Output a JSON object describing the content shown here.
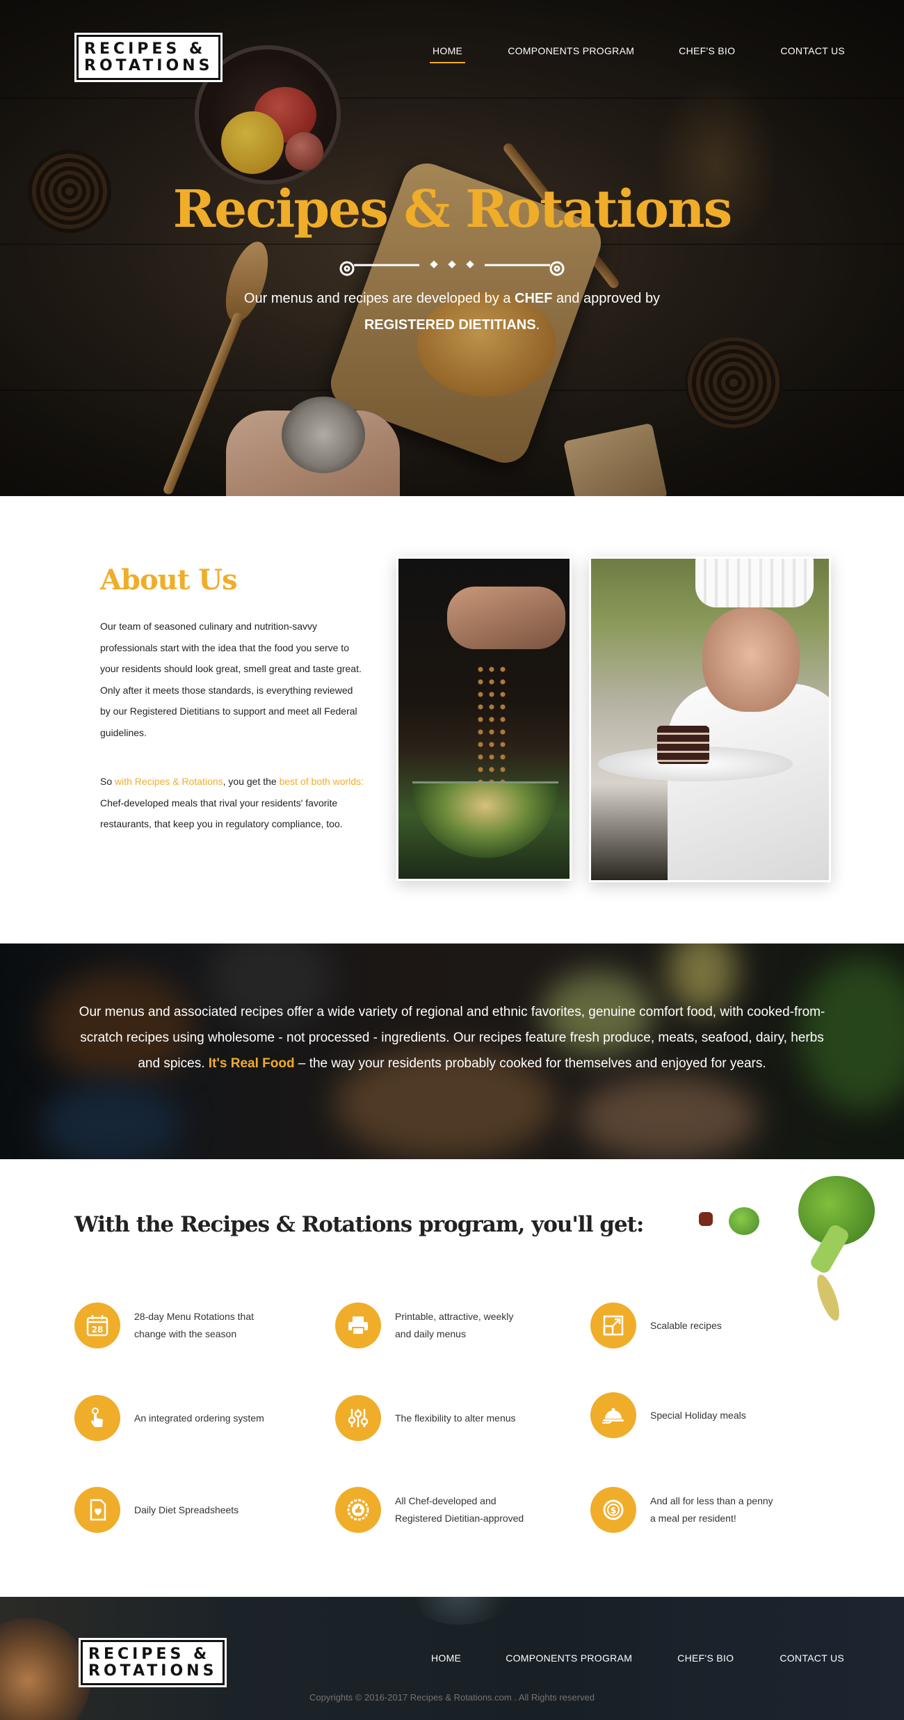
{
  "brand": {
    "line1": "RECIPES &",
    "line2": "ROTATIONS"
  },
  "nav": {
    "items": [
      {
        "label": "HOME",
        "active": true
      },
      {
        "label": "COMPONENTS PROGRAM",
        "active": false
      },
      {
        "label": "CHEF'S BIO",
        "active": false
      },
      {
        "label": "CONTACT US",
        "active": false
      }
    ]
  },
  "hero": {
    "title": "Recipes & Rotations",
    "subtitle_part1": "Our menus and recipes are developed by a ",
    "subtitle_bold1": "CHEF",
    "subtitle_part2": " and approved by",
    "subtitle_bold2": "REGISTERED DIETITIANS",
    "subtitle_end": "."
  },
  "about": {
    "title": "About Us",
    "paragraph1": "Our team of seasoned culinary and nutrition-savvy professionals start with the idea that the food you serve to your residents should look great, smell great and taste great. Only after it meets those standards, is everything reviewed by our Registered Dietitians to support and meet all Federal guidelines.",
    "p2_a": "So ",
    "p2_hl1": "with Recipes & Rotations",
    "p2_b": ", you get the ",
    "p2_hl2": "best of both worlds:",
    "p2_c": " Chef-developed meals that rival your residents' favorite restaurants, that keep you in regulatory compliance, too."
  },
  "banner": {
    "text_a": "Our menus and associated recipes offer a wide variety of regional and ethnic favorites, genuine comfort food, with cooked-from-scratch recipes using wholesome - not processed - ingredients. Our recipes feature fresh produce, meats, seafood, dairy, herbs and spices. ",
    "text_hl": "It's Real Food",
    "text_b": " – the way your residents probably cooked for themselves and enjoyed for years."
  },
  "features": {
    "title": "With the Recipes & Rotations program, you'll get:",
    "items": [
      {
        "icon": "calendar-icon",
        "label1": "28-day Menu Rotations that",
        "label2": "change with the season",
        "calendar_day": "28"
      },
      {
        "icon": "printer-icon",
        "label1": "Printable, attractive, weekly",
        "label2": "and daily menus"
      },
      {
        "icon": "scale-icon",
        "label1": "Scalable recipes",
        "label2": ""
      },
      {
        "icon": "touch-order-icon",
        "label1": "An integrated ordering system",
        "label2": ""
      },
      {
        "icon": "sliders-icon",
        "label1": "The flexibility to alter menus",
        "label2": ""
      },
      {
        "icon": "cloche-icon",
        "label1": "Special Holiday meals",
        "label2": ""
      },
      {
        "icon": "diet-sheet-icon",
        "label1": "Daily Diet Spreadsheets",
        "label2": ""
      },
      {
        "icon": "approved-badge-icon",
        "label1": "All Chef-developed and",
        "label2": "Registered Dietitian-approved"
      },
      {
        "icon": "dollar-coin-icon",
        "label1": "And all for less than a penny",
        "label2": "a meal per resident!"
      }
    ]
  },
  "footer": {
    "copyright": "Copyrights © 2016-2017 Recipes & Rotations.com . All Rights reserved"
  },
  "colors": {
    "accent": "#f0ad2a",
    "dark": "#111111"
  }
}
